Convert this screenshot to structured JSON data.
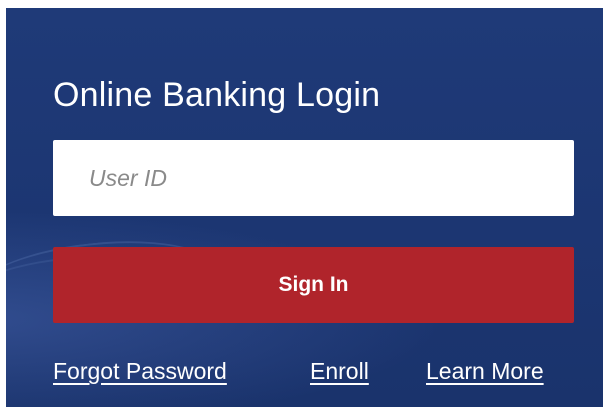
{
  "login": {
    "title": "Online Banking Login",
    "user_id_placeholder": "User ID",
    "user_id_value": "",
    "sign_in_label": "Sign In"
  },
  "links": {
    "forgot_password": "Forgot Password",
    "enroll": "Enroll",
    "learn_more": "Learn More"
  },
  "colors": {
    "panel_background": "#1c3672",
    "sign_in_button": "#b0242b",
    "input_background": "#ffffff",
    "text": "#ffffff"
  }
}
